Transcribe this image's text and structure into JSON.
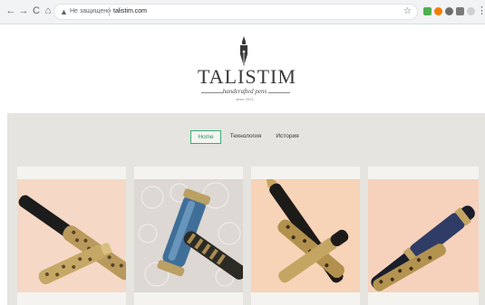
{
  "browser": {
    "security_label": "Не защищено",
    "url": "talistim.com",
    "warning_icon": "warning-triangle-icon",
    "nav_icons": [
      "back-arrow-icon",
      "forward-arrow-icon",
      "reload-icon",
      "home-icon"
    ],
    "extension_icons": [
      "extension-green-icon",
      "extension-orange-icon",
      "extension-grey-icon",
      "extension-puzzle-icon",
      "profile-icon",
      "menu-dots-icon"
    ]
  },
  "site": {
    "brand": "TALISTIM",
    "tagline": "handcrafted pens",
    "since": "since 2013",
    "menu": [
      {
        "label": "Home",
        "active": true
      },
      {
        "label": "Технология",
        "active": false
      },
      {
        "label": "История",
        "active": false
      }
    ],
    "colors": {
      "accent": "#3cab77",
      "band": "#e6e4df",
      "text": "#3a3a3a"
    }
  },
  "products": [
    {
      "image": "gold-filigree-pen-on-peach"
    },
    {
      "image": "blue-barrel-pen-on-lace"
    },
    {
      "image": "black-gold-filigree-pen-on-peach"
    },
    {
      "image": "navy-filigree-pen-on-peach"
    }
  ]
}
